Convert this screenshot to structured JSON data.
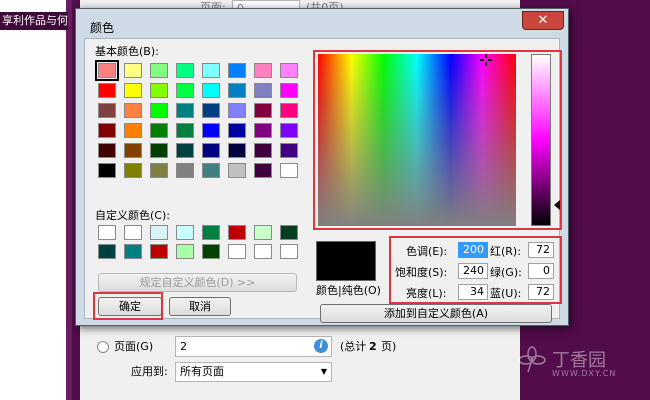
{
  "background": {
    "left_panel_text": "享利作品与何",
    "pages_label": "页面:",
    "pages_value": "0",
    "pages_total": "(共0页)",
    "page_radio_label": "页面(G)",
    "page_value": "2",
    "page_total_prefix": "(总计",
    "page_total_num": "2",
    "page_total_suffix": "页)",
    "apply_to_label": "应用到:",
    "apply_to_value": "所有页面",
    "watermark_text": "丁香园",
    "watermark_url": "WWW.DXY.CN"
  },
  "dialog": {
    "title": "颜色",
    "close_symbol": "✕",
    "basic_colors_label": "基本颜色(B):",
    "custom_colors_label": "自定义颜色(C):",
    "define_custom_button": "规定自定义颜色(D) >>",
    "ok_button": "确定",
    "cancel_button": "取消",
    "color_solid_label": "颜色|纯色(O)",
    "add_custom_button": "添加到自定义颜色(A)",
    "hue_label": "色调(E):",
    "hue_value": "200",
    "sat_label": "饱和度(S):",
    "sat_value": "240",
    "lum_label": "亮度(L):",
    "lum_value": "34",
    "red_label": "红(R):",
    "red_value": "72",
    "green_label": "绿(G):",
    "green_value": "0",
    "blue_label": "蓝(U):",
    "blue_value": "72"
  },
  "basic_colors": [
    "#ff8080",
    "#ffff80",
    "#80ff80",
    "#00ff80",
    "#80ffff",
    "#0080ff",
    "#ff80c0",
    "#ff80ff",
    "#ff0000",
    "#ffff00",
    "#80ff00",
    "#00ff40",
    "#00ffff",
    "#0080c0",
    "#8080c0",
    "#ff00ff",
    "#804040",
    "#ff8040",
    "#00ff00",
    "#008080",
    "#004080",
    "#8080ff",
    "#800040",
    "#ff0080",
    "#800000",
    "#ff8000",
    "#008000",
    "#008040",
    "#0000ff",
    "#0000a0",
    "#800080",
    "#8000ff",
    "#400000",
    "#804000",
    "#004000",
    "#004040",
    "#000080",
    "#000040",
    "#400040",
    "#400080",
    "#000000",
    "#808000",
    "#808040",
    "#808080",
    "#408080",
    "#c0c0c0",
    "#400040",
    "#ffffff"
  ],
  "custom_colors": [
    "#ffffff",
    "#ffffff",
    "#d8f4f4",
    "#c8ffff",
    "#008040",
    "#c00000",
    "#c8ffc8",
    "#004020",
    "#004040",
    "#008080",
    "#c00000",
    "#aaffaa",
    "#004000",
    "#ffffff",
    "#ffffff",
    "#ffffff"
  ],
  "colors": {
    "highlight": "#e0353b",
    "selected_color": "#000000"
  }
}
